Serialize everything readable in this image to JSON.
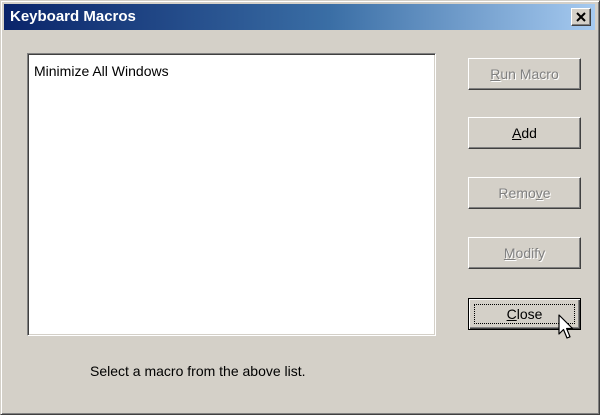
{
  "window": {
    "title": "Keyboard Macros"
  },
  "macros": {
    "items": [
      {
        "label": "Minimize All Windows"
      }
    ]
  },
  "buttons": {
    "run_macro": {
      "label": "Run Macro",
      "accel": "R",
      "rest": "un Macro",
      "enabled": false
    },
    "add": {
      "label": "Add",
      "accel": "A",
      "rest": "dd",
      "enabled": true
    },
    "remove": {
      "label": "Remove",
      "pre": "Remo",
      "accel": "v",
      "rest": "e",
      "enabled": false
    },
    "modify": {
      "label": "Modify",
      "accel": "M",
      "rest": "odify",
      "enabled": false
    },
    "close": {
      "label": "Close",
      "accel": "C",
      "rest": "lose",
      "enabled": true,
      "default": true
    }
  },
  "status": {
    "message": "Select a macro from the above list."
  },
  "colors": {
    "title_gradient_start": "#0a246a",
    "title_gradient_end": "#a6caf0",
    "face": "#d4d0c8",
    "disabled_text": "#808080"
  }
}
